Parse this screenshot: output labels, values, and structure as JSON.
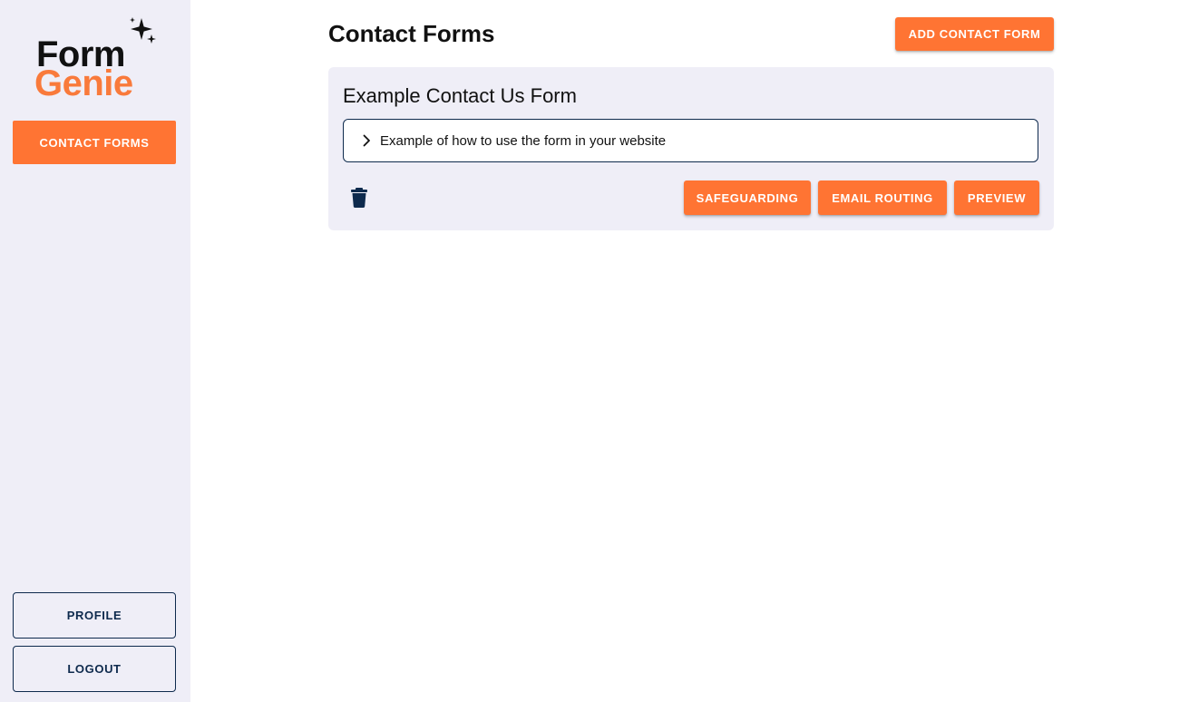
{
  "brand": {
    "logo_word1": "Form",
    "logo_word2": "Genie",
    "accent_color": "#ff7433",
    "dark_color": "#0e2a4d",
    "sidebar_bg": "#efeef7"
  },
  "sidebar": {
    "nav_contact_forms": "CONTACT FORMS",
    "profile_label": "PROFILE",
    "logout_label": "LOGOUT"
  },
  "header": {
    "title": "Contact Forms",
    "add_button_label": "ADD CONTACT FORM"
  },
  "forms": [
    {
      "title": "Example Contact Us Form",
      "accordion_label": "Example of how to use the form in your website",
      "delete_icon": "trash-icon",
      "actions": {
        "safeguarding": "SAFEGUARDING",
        "email_routing": "EMAIL ROUTING",
        "preview": "PREVIEW"
      }
    }
  ]
}
